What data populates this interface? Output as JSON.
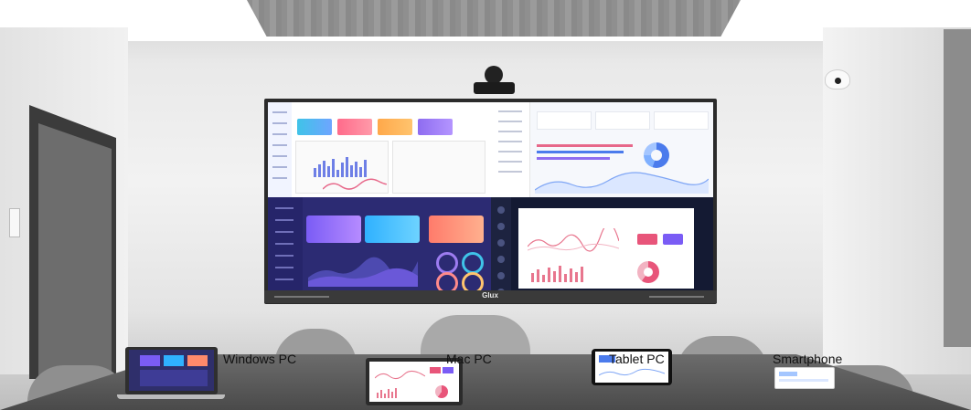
{
  "display": {
    "brand": "Glux"
  },
  "devices": [
    {
      "label": "Windows PC"
    },
    {
      "label": "Mac PC"
    },
    {
      "label": "Tablet PC"
    },
    {
      "label": "Smartphone"
    }
  ],
  "colors": {
    "dashboard_purple": "#2c2b73",
    "dashboard_navy": "#141a33",
    "accent_blue": "#4b7bec",
    "accent_pink": "#e8557a"
  }
}
